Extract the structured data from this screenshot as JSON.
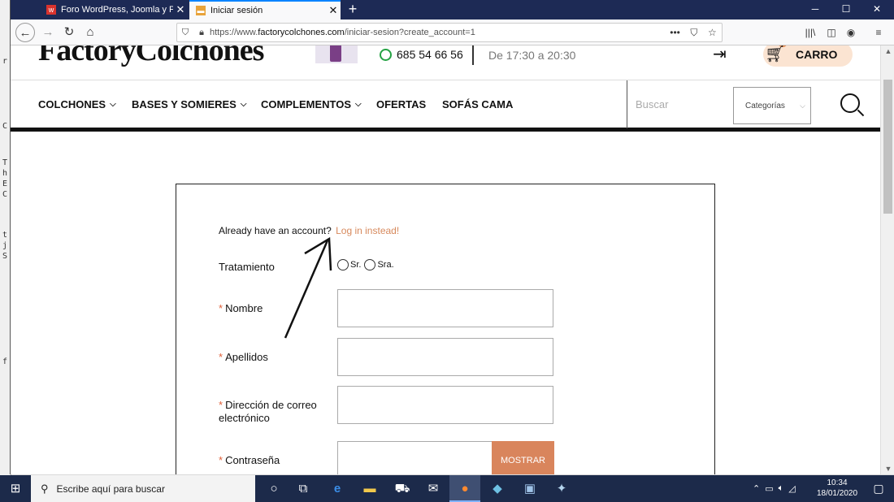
{
  "browser": {
    "tabs": [
      {
        "title": "Foro WordPress, Joomla y Pres",
        "icon": "webempresa-favicon-icon",
        "close": "✕"
      },
      {
        "title": "Iniciar sesión",
        "icon": "bed-favicon-icon",
        "close": "✕"
      }
    ],
    "new_tab": "+",
    "url_prefix": "https://www.",
    "url_domain": "factorycolchones.com",
    "url_path": "/iniciar-sesion?create_account=1",
    "window_controls": [
      "─",
      "☐",
      "✕"
    ]
  },
  "site": {
    "logo": "FactoryColchones",
    "phone": "685 54 66 56",
    "hours": "De 17:30 a 20:30",
    "cart_label": "CARRO",
    "menu": [
      {
        "label": "COLCHONES",
        "chevron": "⌵"
      },
      {
        "label": "BASES Y SOMIERES",
        "chevron": "⌵"
      },
      {
        "label": "COMPLEMENTOS",
        "chevron": "⌵"
      },
      {
        "label": "OFERTAS",
        "chevron": ""
      },
      {
        "label": "SOFÁS CAMA",
        "chevron": ""
      }
    ],
    "search_placeholder": "Buscar",
    "category_select": "Categorías",
    "category_dropdown": "⌵"
  },
  "form": {
    "already_text": "Already have an account?",
    "login_link": "Log in instead!",
    "title_label": "Tratamiento",
    "title_options": [
      "Sr.",
      "Sra."
    ],
    "required_mark": "*",
    "fields": [
      {
        "label": "Nombre",
        "value": ""
      },
      {
        "label": "Apellidos",
        "value": ""
      },
      {
        "label": "Dirección de correo electrónico",
        "value": ""
      },
      {
        "label": "Contraseña",
        "value": ""
      }
    ],
    "show_button": "MOSTRAR"
  },
  "taskbar": {
    "search_placeholder": "Escribe aquí para buscar",
    "time": "10:34",
    "date": "18/01/2020"
  },
  "colors": {
    "accent": "#d9855c",
    "link": "#d7895c",
    "tabbar": "#1d2a55",
    "taskbar": "#1c2a4a"
  }
}
